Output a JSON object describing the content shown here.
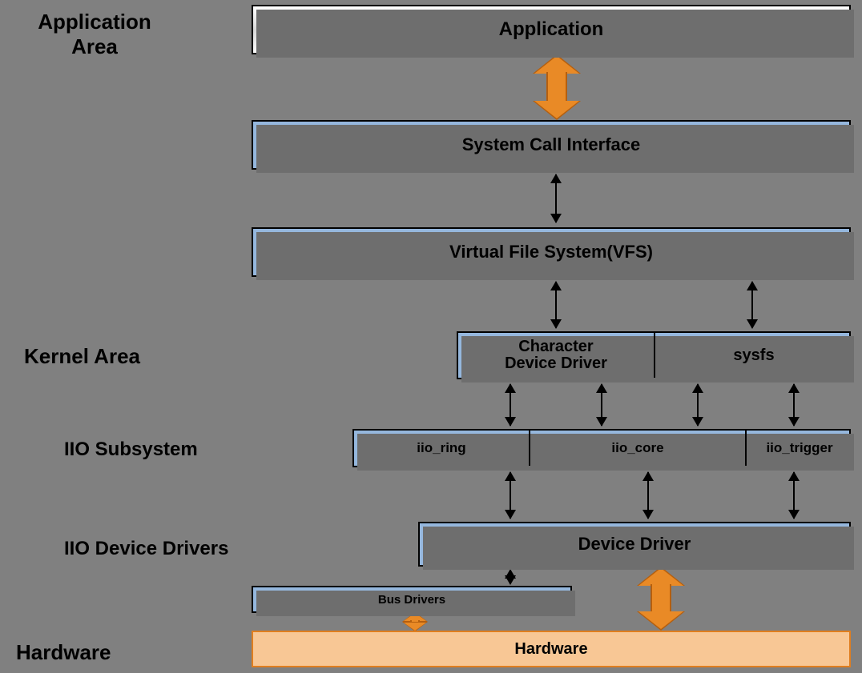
{
  "labels": {
    "application_area": "Application\nArea",
    "kernel_area": "Kernel Area",
    "iio_subsystem": "IIO Subsystem",
    "iio_device_drivers": "IIO Device Drivers",
    "hardware_label": "Hardware"
  },
  "boxes": {
    "application": "Application",
    "system_call_interface": "System Call Interface",
    "vfs": "Virtual File System(VFS)",
    "char_device_driver_line1": "Character",
    "char_device_driver_line2": "Device Driver",
    "sysfs": "sysfs",
    "iio_ring": "iio_ring",
    "iio_core": "iio_core",
    "iio_trigger": "iio_trigger",
    "device_driver": "Device Driver",
    "bus_drivers": "Bus Drivers",
    "hardware": "Hardware"
  },
  "chart_data": {
    "type": "layered-architecture-diagram",
    "layers": [
      {
        "area": "Application Area",
        "nodes": [
          "Application"
        ]
      },
      {
        "area": "Kernel Area",
        "nodes": [
          "System Call Interface"
        ]
      },
      {
        "area": "Kernel Area",
        "nodes": [
          "Virtual File System(VFS)"
        ]
      },
      {
        "area": "Kernel Area",
        "nodes": [
          "Character Device Driver",
          "sysfs"
        ]
      },
      {
        "area": "IIO Subsystem",
        "nodes": [
          "iio_ring",
          "iio_core",
          "iio_trigger"
        ]
      },
      {
        "area": "IIO Device Drivers",
        "nodes": [
          "Device Driver"
        ]
      },
      {
        "area": "IIO Device Drivers",
        "nodes": [
          "Bus Drivers"
        ]
      },
      {
        "area": "Hardware",
        "nodes": [
          "Hardware"
        ]
      }
    ],
    "edges": [
      {
        "from": "Application",
        "to": "System Call Interface",
        "style": "thick-orange",
        "bidirectional": true
      },
      {
        "from": "System Call Interface",
        "to": "Virtual File System(VFS)",
        "style": "thin-black",
        "bidirectional": true
      },
      {
        "from": "Virtual File System(VFS)",
        "to": "Character Device Driver",
        "style": "thin-black",
        "bidirectional": true
      },
      {
        "from": "Virtual File System(VFS)",
        "to": "sysfs",
        "style": "thin-black",
        "bidirectional": true
      },
      {
        "from": "Character Device Driver",
        "to": "iio_ring",
        "style": "thin-black",
        "bidirectional": true
      },
      {
        "from": "Character Device Driver",
        "to": "iio_core",
        "style": "thin-black",
        "bidirectional": true
      },
      {
        "from": "sysfs",
        "to": "iio_core",
        "style": "thin-black",
        "bidirectional": true
      },
      {
        "from": "sysfs",
        "to": "iio_trigger",
        "style": "thin-black",
        "bidirectional": true
      },
      {
        "from": "iio_ring",
        "to": "Device Driver",
        "style": "thin-black",
        "bidirectional": true
      },
      {
        "from": "iio_core",
        "to": "Device Driver",
        "style": "thin-black",
        "bidirectional": true
      },
      {
        "from": "iio_trigger",
        "to": "Device Driver",
        "style": "thin-black",
        "bidirectional": true
      },
      {
        "from": "Device Driver",
        "to": "Bus Drivers",
        "style": "thin-black",
        "bidirectional": true
      },
      {
        "from": "Device Driver",
        "to": "Hardware",
        "style": "thick-orange",
        "bidirectional": true
      },
      {
        "from": "Bus Drivers",
        "to": "Hardware",
        "style": "thick-orange",
        "bidirectional": true
      }
    ]
  }
}
